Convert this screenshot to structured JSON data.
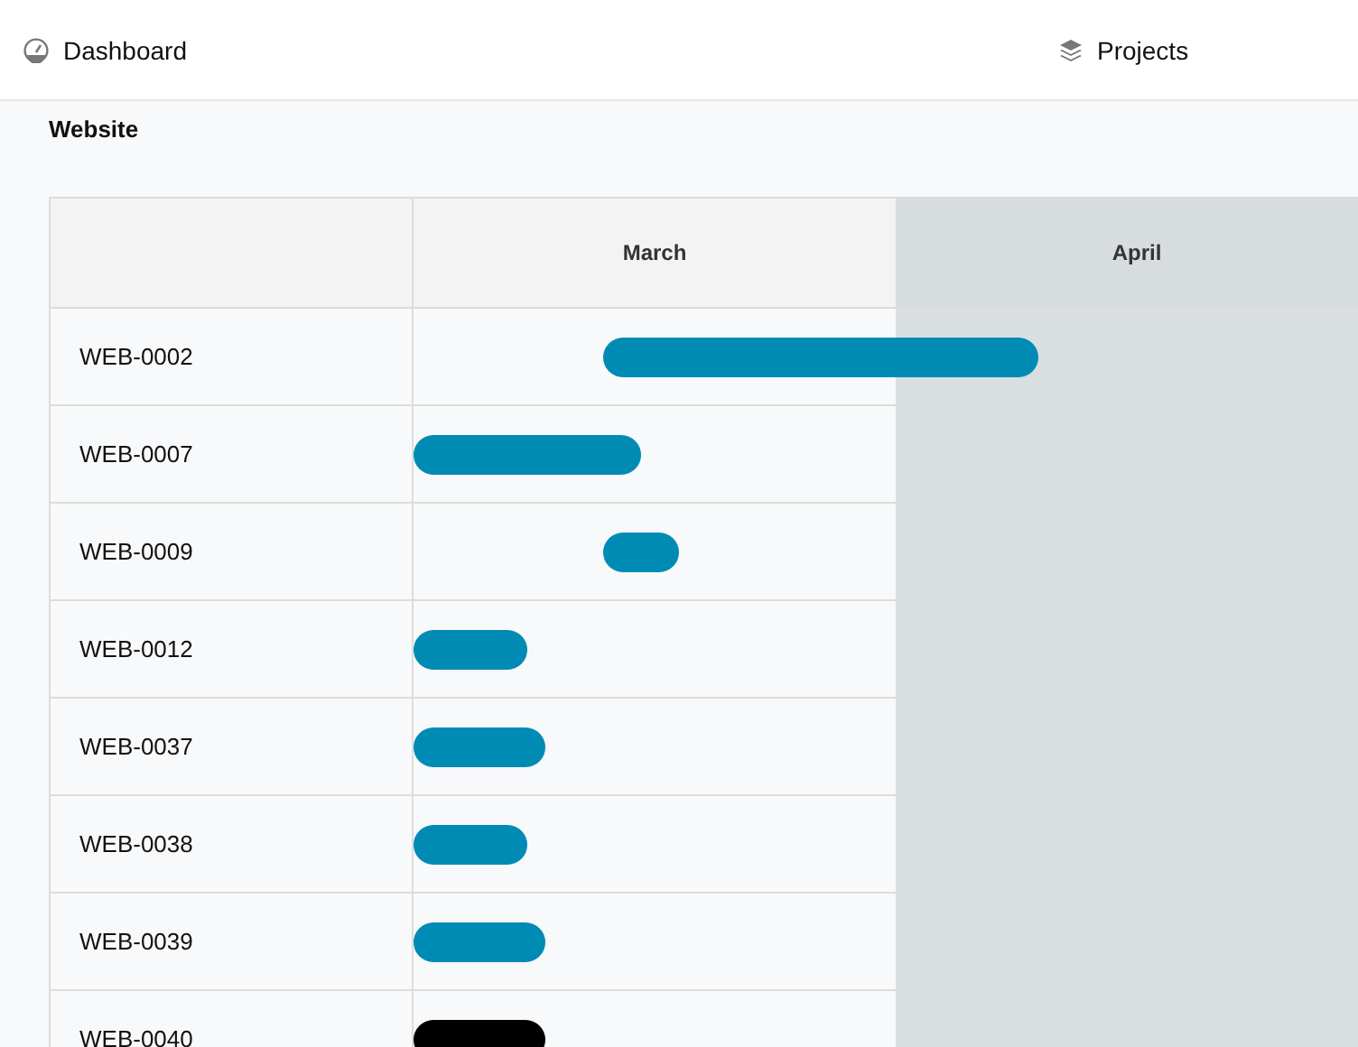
{
  "nav": [
    {
      "label": "Dashboard",
      "kind": "dashboard"
    },
    {
      "label": "Projects",
      "kind": "projects"
    }
  ],
  "project_title": "Website",
  "gantt": {
    "months": [
      "March",
      "April"
    ],
    "rows": [
      {
        "id": "WEB-0002",
        "selected": false
      },
      {
        "id": "WEB-0007",
        "selected": false
      },
      {
        "id": "WEB-0009",
        "selected": false
      },
      {
        "id": "WEB-0012",
        "selected": false
      },
      {
        "id": "WEB-0037",
        "selected": false
      },
      {
        "id": "WEB-0038",
        "selected": false
      },
      {
        "id": "WEB-0039",
        "selected": false
      },
      {
        "id": "WEB-0040",
        "selected": true
      }
    ]
  }
}
